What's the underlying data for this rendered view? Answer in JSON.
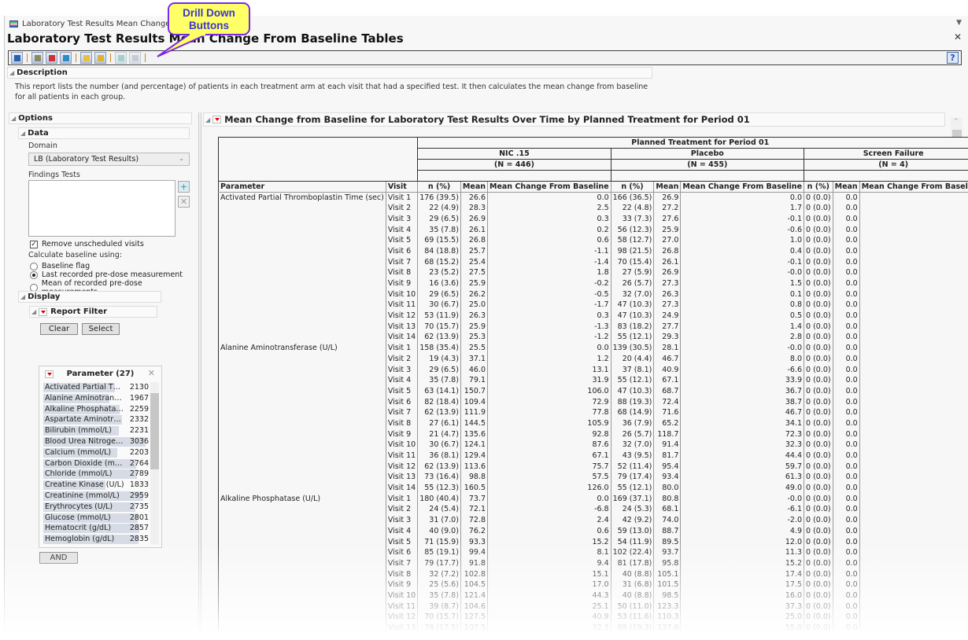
{
  "window": {
    "tab_title": "Laboratory Test Results Mean Change From",
    "title": "Laboratory Test Results Mean Change From Baseline Tables"
  },
  "callout": {
    "line1": "Drill Down",
    "line2": "Buttons"
  },
  "description": {
    "heading": "Description",
    "text": "This report lists the number (and percentage) of patients in each treatment arm at each visit that had a specified test. It then calculates the mean change from baseline for all patients in each group."
  },
  "options": {
    "heading": "Options",
    "data_heading": "Data",
    "domain_label": "Domain",
    "domain_value": "LB (Laboratory Test Results)",
    "findings_label": "Findings Tests",
    "remove_unscheduled": "Remove unscheduled visits",
    "remove_unscheduled_checked": true,
    "baseline_label": "Calculate baseline using:",
    "baseline_options": [
      "Baseline flag",
      "Last recorded pre-dose measurement",
      "Mean of recorded pre-dose measurements"
    ],
    "baseline_selected": 1,
    "display_heading": "Display",
    "report_filter": "Report Filter",
    "clear": "Clear",
    "select": "Select",
    "and": "AND"
  },
  "filter": {
    "title": "Parameter (27)",
    "items": [
      {
        "name": "Activated Partial Thro...",
        "count": 2130
      },
      {
        "name": "Alanine Aminotransfer...",
        "count": 1967
      },
      {
        "name": "Alkaline Phosphatase (...",
        "count": 2259
      },
      {
        "name": "Aspartate Aminotransf...",
        "count": 2332
      },
      {
        "name": "Bilirubin (mmol/L)",
        "count": 2231
      },
      {
        "name": "Blood Urea Nitrogen (...",
        "count": 3036
      },
      {
        "name": "Calcium (mmol/L)",
        "count": 2203
      },
      {
        "name": "Carbon Dioxide (mg/dL)",
        "count": 2764
      },
      {
        "name": "Chloride (mmol/L)",
        "count": 2789
      },
      {
        "name": "Creatine Kinase (U/L)",
        "count": 1833
      },
      {
        "name": "Creatinine (mmol/L)",
        "count": 2959
      },
      {
        "name": "Erythrocytes (U/L)",
        "count": 2735
      },
      {
        "name": "Glucose (mmol/L)",
        "count": 2801
      },
      {
        "name": "Hematocrit (g/dL)",
        "count": 2857
      },
      {
        "name": "Hemoglobin (g/dL)",
        "count": 2835
      }
    ]
  },
  "report": {
    "title": "Mean Change from Baseline for Laboratory Test Results Over Time by Planned Treatment for Period 01",
    "group_header": "Planned Treatment for Period 01",
    "arms": [
      {
        "name": "NIC .15",
        "n": "(N = 446)"
      },
      {
        "name": "Placebo",
        "n": "(N = 455)"
      },
      {
        "name": "Screen Failure",
        "n": "(N = 4)"
      }
    ],
    "columns": [
      "Parameter",
      "Visit",
      "n (%)",
      "Mean",
      "Mean Change From Baseline"
    ],
    "parameters": [
      {
        "name": "Activated Partial Thromboplastin Time (sec)",
        "rows": [
          [
            "Visit 1",
            "176 (39.5)",
            "26.6",
            "0.0",
            "166 (36.5)",
            "26.9",
            "0.0"
          ],
          [
            "Visit 2",
            "22 (4.9)",
            "28.3",
            "2.5",
            "22 (4.8)",
            "27.2",
            "1.7"
          ],
          [
            "Visit 3",
            "29 (6.5)",
            "26.9",
            "0.3",
            "33 (7.3)",
            "27.6",
            "-0.1"
          ],
          [
            "Visit 4",
            "35 (7.8)",
            "26.1",
            "0.2",
            "56 (12.3)",
            "25.9",
            "-0.6"
          ],
          [
            "Visit 5",
            "69 (15.5)",
            "26.8",
            "0.6",
            "58 (12.7)",
            "27.0",
            "1.0"
          ],
          [
            "Visit 6",
            "84 (18.8)",
            "25.7",
            "-1.1",
            "98 (21.5)",
            "26.8",
            "0.4"
          ],
          [
            "Visit 7",
            "68 (15.2)",
            "25.4",
            "-1.4",
            "70 (15.4)",
            "26.1",
            "-0.1"
          ],
          [
            "Visit 8",
            "23 (5.2)",
            "27.5",
            "1.8",
            "27 (5.9)",
            "26.9",
            "-0.0"
          ],
          [
            "Visit 9",
            "16 (3.6)",
            "25.9",
            "-0.2",
            "26 (5.7)",
            "27.3",
            "1.5"
          ],
          [
            "Visit 10",
            "29 (6.5)",
            "26.2",
            "-0.5",
            "32 (7.0)",
            "26.3",
            "0.1"
          ],
          [
            "Visit 11",
            "30 (6.7)",
            "25.0",
            "-1.7",
            "47 (10.3)",
            "27.3",
            "0.8"
          ],
          [
            "Visit 12",
            "53 (11.9)",
            "26.3",
            "0.3",
            "47 (10.3)",
            "24.9",
            "0.5"
          ],
          [
            "Visit 13",
            "70 (15.7)",
            "25.9",
            "-1.3",
            "83 (18.2)",
            "27.7",
            "1.4"
          ],
          [
            "Visit 14",
            "62 (13.9)",
            "25.3",
            "-1.2",
            "55 (12.1)",
            "29.3",
            "2.8"
          ]
        ]
      },
      {
        "name": "Alanine Aminotransferase (U/L)",
        "rows": [
          [
            "Visit 1",
            "158 (35.4)",
            "25.5",
            "0.0",
            "139 (30.5)",
            "28.1",
            "-0.0"
          ],
          [
            "Visit 2",
            "19 (4.3)",
            "37.1",
            "1.2",
            "20 (4.4)",
            "46.7",
            "8.0"
          ],
          [
            "Visit 3",
            "29 (6.5)",
            "46.0",
            "13.1",
            "37 (8.1)",
            "40.9",
            "-6.6"
          ],
          [
            "Visit 4",
            "35 (7.8)",
            "79.1",
            "31.9",
            "55 (12.1)",
            "67.1",
            "33.9"
          ],
          [
            "Visit 5",
            "63 (14.1)",
            "150.7",
            "106.0",
            "47 (10.3)",
            "68.7",
            "36.7"
          ],
          [
            "Visit 6",
            "82 (18.4)",
            "109.4",
            "72.9",
            "88 (19.3)",
            "72.4",
            "38.7"
          ],
          [
            "Visit 7",
            "62 (13.9)",
            "111.9",
            "77.8",
            "68 (14.9)",
            "71.6",
            "46.7"
          ],
          [
            "Visit 8",
            "27 (6.1)",
            "144.5",
            "105.9",
            "36 (7.9)",
            "65.2",
            "34.1"
          ],
          [
            "Visit 9",
            "21 (4.7)",
            "135.6",
            "92.8",
            "26 (5.7)",
            "118.7",
            "72.3"
          ],
          [
            "Visit 10",
            "30 (6.7)",
            "124.1",
            "87.6",
            "32 (7.0)",
            "91.4",
            "32.3"
          ],
          [
            "Visit 11",
            "36 (8.1)",
            "129.4",
            "67.1",
            "43 (9.5)",
            "81.7",
            "44.4"
          ],
          [
            "Visit 12",
            "62 (13.9)",
            "113.6",
            "75.7",
            "52 (11.4)",
            "95.4",
            "59.7"
          ],
          [
            "Visit 13",
            "73 (16.4)",
            "98.8",
            "57.5",
            "79 (17.4)",
            "93.4",
            "61.3"
          ],
          [
            "Visit 14",
            "55 (12.3)",
            "160.5",
            "126.0",
            "55 (12.1)",
            "80.0",
            "49.0"
          ]
        ]
      },
      {
        "name": "Alkaline Phosphatase (U/L)",
        "rows": [
          [
            "Visit 1",
            "180 (40.4)",
            "73.7",
            "0.0",
            "169 (37.1)",
            "80.8",
            "-0.0"
          ],
          [
            "Visit 2",
            "24 (5.4)",
            "72.1",
            "-6.8",
            "24 (5.3)",
            "68.1",
            "-6.1"
          ],
          [
            "Visit 3",
            "31 (7.0)",
            "72.8",
            "2.4",
            "42 (9.2)",
            "74.0",
            "-2.0"
          ],
          [
            "Visit 4",
            "40 (9.0)",
            "76.2",
            "0.6",
            "59 (13.0)",
            "88.7",
            "4.9"
          ],
          [
            "Visit 5",
            "71 (15.9)",
            "93.3",
            "15.2",
            "54 (11.9)",
            "89.5",
            "12.0"
          ],
          [
            "Visit 6",
            "85 (19.1)",
            "99.4",
            "8.1",
            "102 (22.4)",
            "93.7",
            "11.3"
          ],
          [
            "Visit 7",
            "79 (17.7)",
            "91.8",
            "9.4",
            "81 (17.8)",
            "95.8",
            "15.2"
          ],
          [
            "Visit 8",
            "32 (7.2)",
            "102.8",
            "15.1",
            "40 (8.8)",
            "105.1",
            "17.4"
          ],
          [
            "Visit 9",
            "25 (5.6)",
            "104.5",
            "17.0",
            "31 (6.8)",
            "101.5",
            "17.5"
          ],
          [
            "Visit 10",
            "35 (7.8)",
            "121.4",
            "44.3",
            "40 (8.8)",
            "98.5",
            "16.0"
          ],
          [
            "Visit 11",
            "39 (8.7)",
            "104.6",
            "25.1",
            "50 (11.0)",
            "123.3",
            "37.3"
          ],
          [
            "Visit 12",
            "70 (15.7)",
            "127.5",
            "40.9",
            "53 (11.6)",
            "110.3",
            "25.0"
          ],
          [
            "Visit 13",
            "78 (17.5)",
            "107.5",
            "32.3",
            "88 (19.3)",
            "137.6",
            "55.0"
          ]
        ]
      }
    ],
    "screen_failure_values": [
      "0 (0.0)",
      "0.0",
      "0.0"
    ]
  }
}
